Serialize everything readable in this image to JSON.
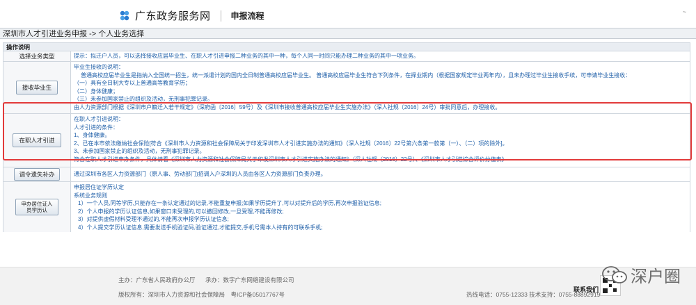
{
  "header": {
    "logo_text": "广东政务服务网",
    "subtitle": "申报流程",
    "top_right": "~"
  },
  "breadcrumb": "深圳市人才引进业务申报 -> 个人业务选择",
  "section_title": "操作说明",
  "rows": {
    "select": {
      "label": "选择业务类型",
      "text": "提示：拟迁户人员，可以选择接收应届毕业生、在职人才引进申报二种业务的其中一种，每个人同一时间只能办理二种业务的其中一项业务。"
    },
    "graduate": {
      "button": "接收毕业生",
      "lines": [
        "毕业生接收的说明：",
        "普通高校应届毕业生是指纳入全国统一招生，统一派遣计划的国内全日制普通高校应届毕业生。 普通高校应届毕业生符合下列条件，在择业期内（根据国家规定毕业两年内），且未办理过毕业生接收手续，可申请毕业生接收：",
        "（一）具有全日制大专以上普通高等教育学历；",
        "（二）身体健康；",
        "（三）未参加国家禁止的组织及活动，无刑事犯罪记录。",
        "由人力资源部门根据《深圳市户籍迁入若干规定》（深府函〔2016〕59号）及《深圳市接收普通高校应届毕业生实施办法》（深人社规〔2016〕24号）审批同意后，办理接收。"
      ]
    },
    "talent": {
      "button": "在职人才引进",
      "lines": [
        "在职人才引进说明：",
        "人才引进的条件：",
        "1、身体健康。",
        "2、已在本市依法缴纳社会保险[符合《深圳市人力资源和社会保障局关于印发深圳市人才引进实施办法的通知》（深人社规〔2016〕22号第六条第一款第（一）、（二）项的除外]。",
        "3、未参加国家禁止的组织及活动，无刑事犯罪记录。",
        "符合在职人才引进申办条件，具体请看《深圳市人力资源和社会保障局关于印发深圳市人才引进实施办法的通知》（深人社规〔2016〕22号）、《深圳市人才引进综合评价分值表》"
      ]
    },
    "transfer": {
      "button": "调令遗失补办",
      "text": "通过深圳市各区人力资源部门（原人事、劳动部门)招调入户深圳的人员由各区人力资源部门负责办理。"
    },
    "cert": {
      "button": "申办居住证人员学历认",
      "lines": [
        "申报居住证学历认定",
        "系统业务规则",
        "1）一个人员,同等学历,只能存在一条认定通过的记录,不能重复申报;如果学历提升了,可以对提升后的学历,再次申报验证信息;",
        "2）个人申报的学历认证信息,如果窗口未受理的,可以撤回修改,一旦受理,不能再修改;",
        "3）对提供虚假材料受理不通过的,不能再次申报学历认证信息;",
        "4）个人提交学历认证信息,需要发送手机验证码,验证通过,才能提交,手机号需本人持有的可联系手机;"
      ]
    }
  },
  "footer": {
    "host": "主办：广东省人民政府办公厅",
    "undertake": "承办：数字广东网络建设有限公司",
    "copyright": "版权所有：深圳市人力资源和社会保障局　粤ICP备05017767号",
    "hotline": "热线电话：0755-12333 技术支持：0755-88892919",
    "contact": "联系我们"
  },
  "watermark": "深户圈",
  "colors": {
    "accent_blue": "#1f5fa8",
    "highlight_red": "#e23a3a"
  }
}
